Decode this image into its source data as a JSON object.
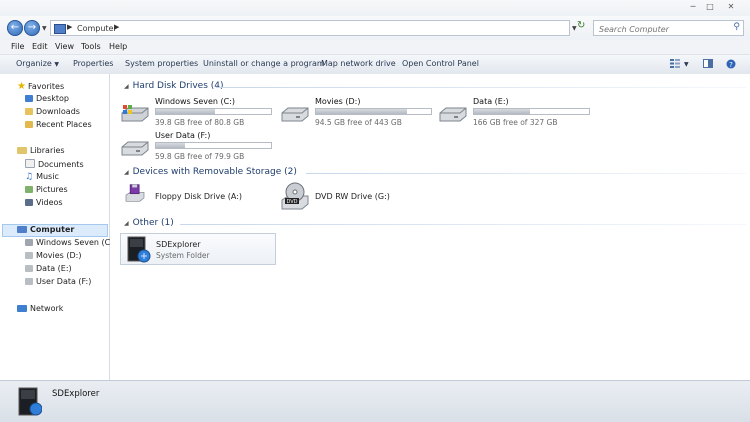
{
  "nav": {
    "address_crumb": "Computer",
    "search_placeholder": "Search Computer"
  },
  "menu": [
    "File",
    "Edit",
    "View",
    "Tools",
    "Help"
  ],
  "toolbar": {
    "organize": "Organize",
    "properties": "Properties",
    "system_properties": "System properties",
    "uninstall": "Uninstall or change a program",
    "map_drive": "Map network drive",
    "control_panel": "Open Control Panel"
  },
  "sidebar": {
    "favorites": {
      "label": "Favorites",
      "items": [
        "Desktop",
        "Downloads",
        "Recent Places"
      ]
    },
    "libraries": {
      "label": "Libraries",
      "items": [
        "Documents",
        "Music",
        "Pictures",
        "Videos"
      ]
    },
    "computer": {
      "label": "Computer",
      "items": [
        "Windows Seven (C:)",
        "Movies (D:)",
        "Data (E:)",
        "User Data (F:)"
      ]
    },
    "network": {
      "label": "Network"
    }
  },
  "groups": {
    "hdd": {
      "header": "Hard Disk Drives (4)",
      "drives": [
        {
          "name": "Windows Seven (C:)",
          "free": "39.8 GB free of 80.8 GB",
          "used_fraction": 0.51
        },
        {
          "name": "Movies (D:)",
          "free": "94.5 GB free of 443 GB",
          "used_fraction": 0.79
        },
        {
          "name": "Data (E:)",
          "free": "166 GB free of 327 GB",
          "used_fraction": 0.49
        },
        {
          "name": "User Data (F:)",
          "free": "59.8 GB free of 79.9 GB",
          "used_fraction": 0.25
        }
      ]
    },
    "removable": {
      "header": "Devices with Removable Storage (2)",
      "items": [
        {
          "name": "Floppy Disk Drive (A:)",
          "icon": "floppy-icon"
        },
        {
          "name": "DVD RW Drive (G:)",
          "icon": "dvd-drive-icon"
        }
      ]
    },
    "other": {
      "header": "Other (1)",
      "item": {
        "name": "SDExplorer",
        "type": "System Folder"
      }
    }
  },
  "details": {
    "name": "SDExplorer"
  },
  "colors": {
    "accent": "#1e3d6e",
    "selection": "#dcebfc",
    "nav_button": "#2a63b5"
  }
}
